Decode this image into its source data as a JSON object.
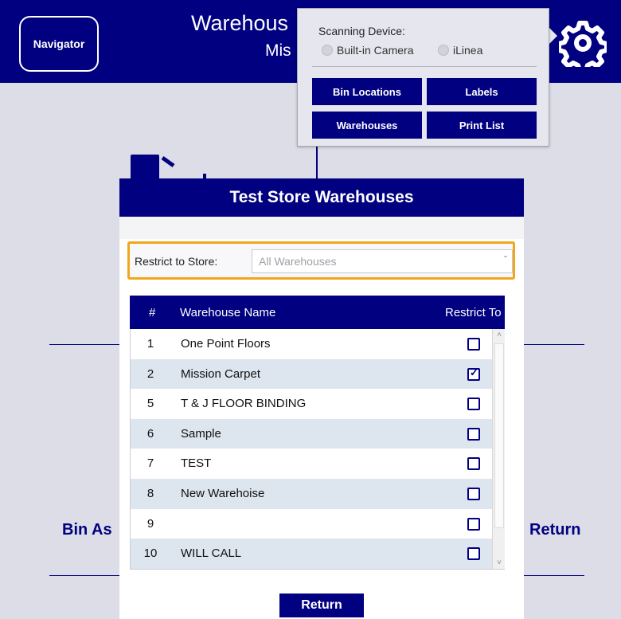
{
  "colors": {
    "brand": "#000080",
    "highlight": "#f0a719",
    "row_alt": "#dde5ee"
  },
  "header": {
    "nav_label": "Navigator",
    "title": "Warehous",
    "subtitle": "Mis",
    "settings_icon": "gear-icon"
  },
  "background": {
    "left_label": "Bin As",
    "right_label": "Return"
  },
  "settings_popover": {
    "scanning_caption": "Scanning Device:",
    "radio_options": [
      {
        "label": "Built-in Camera",
        "selected": false
      },
      {
        "label": "iLinea",
        "selected": false
      }
    ],
    "buttons": [
      "Bin Locations",
      "Labels",
      "Warehouses",
      "Print List"
    ]
  },
  "modal": {
    "title": "Test Store  Warehouses",
    "restrict_label": "Restrict to Store:",
    "restrict_value": "All Warehouses",
    "columns": [
      "#",
      "Warehouse Name",
      "Restrict To"
    ],
    "rows": [
      {
        "num": "1",
        "name": "One Point Floors",
        "checked": false
      },
      {
        "num": "2",
        "name": "Mission Carpet",
        "checked": true
      },
      {
        "num": "5",
        "name": "T & J FLOOR BINDING",
        "checked": false
      },
      {
        "num": "6",
        "name": "Sample",
        "checked": false
      },
      {
        "num": "7",
        "name": "TEST",
        "checked": false
      },
      {
        "num": "8",
        "name": "New Warehoise",
        "checked": false
      },
      {
        "num": "9",
        "name": "",
        "checked": false
      },
      {
        "num": "10",
        "name": "WILL CALL",
        "checked": false
      }
    ],
    "return_label": "Return"
  }
}
